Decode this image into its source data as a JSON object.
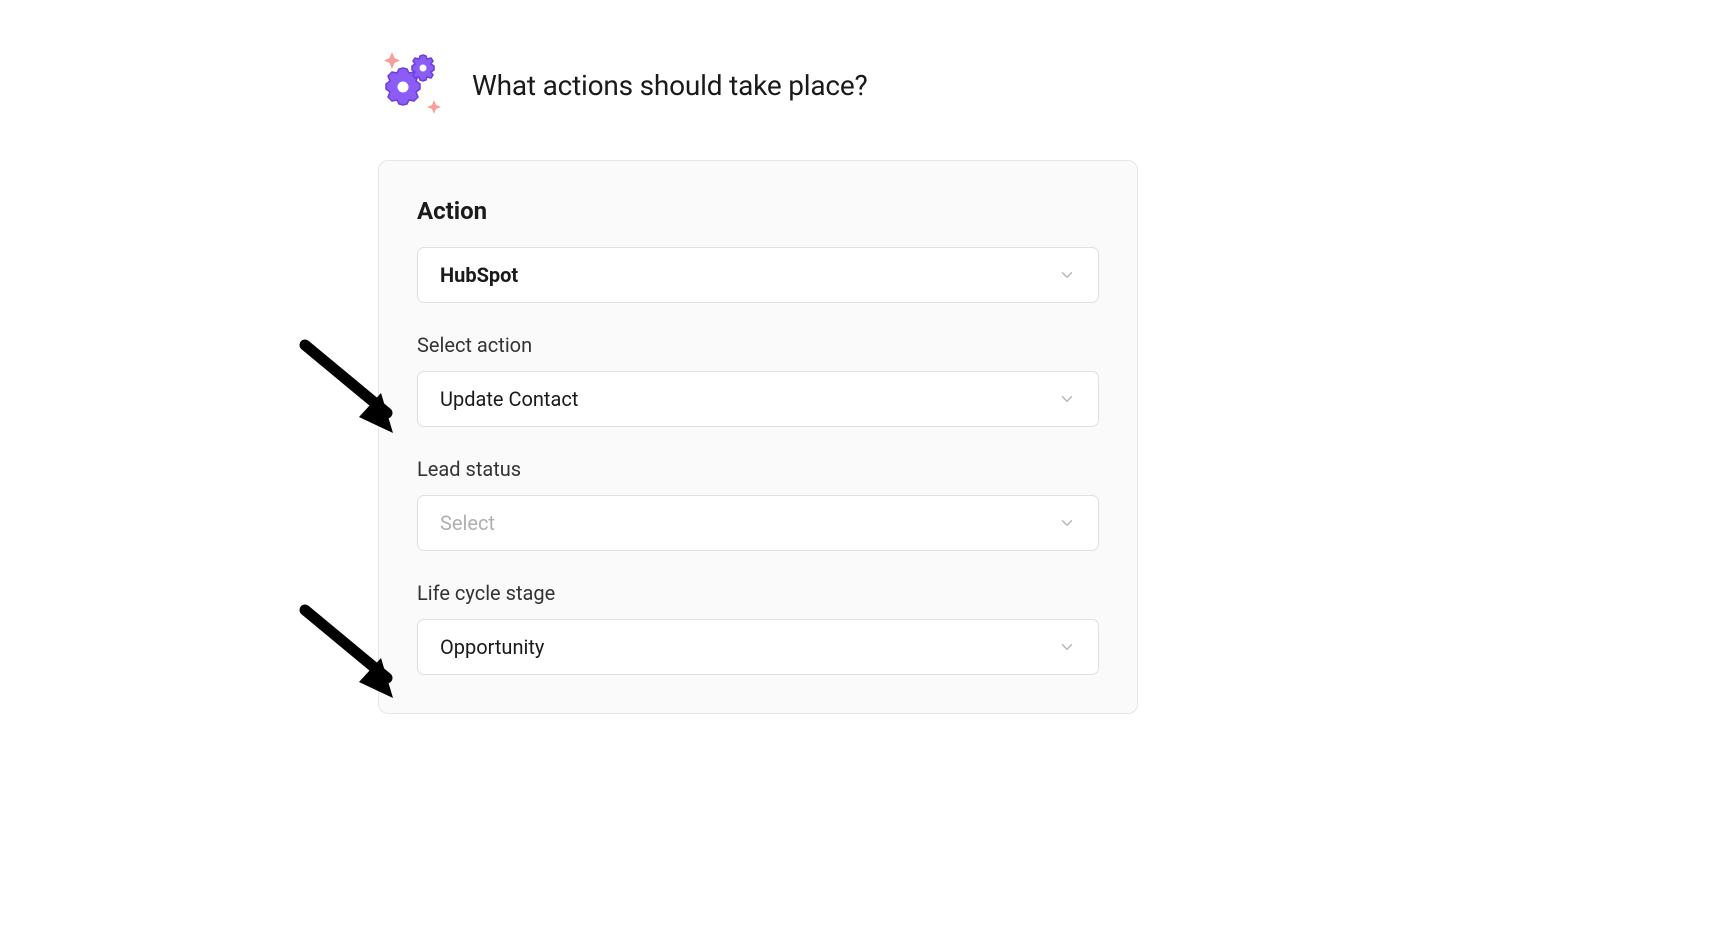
{
  "header": {
    "title": "What actions should take place?"
  },
  "card": {
    "heading": "Action",
    "integration": {
      "value": "HubSpot"
    },
    "select_action": {
      "label": "Select action",
      "value": "Update Contact"
    },
    "lead_status": {
      "label": "Lead status",
      "placeholder": "Select"
    },
    "life_cycle_stage": {
      "label": "Life cycle stage",
      "value": "Opportunity"
    }
  }
}
